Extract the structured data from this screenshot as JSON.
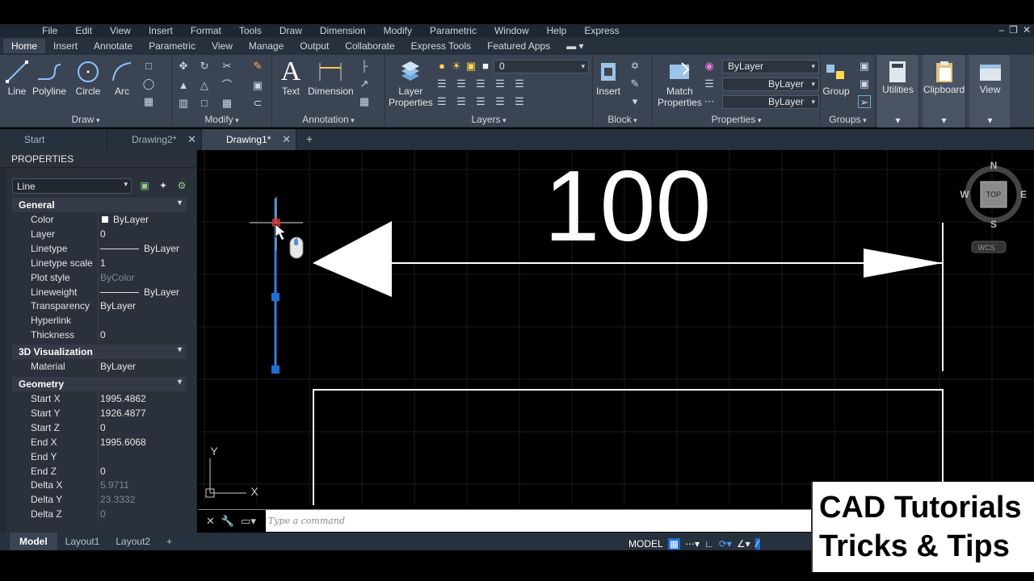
{
  "menu": {
    "items": [
      "File",
      "Edit",
      "View",
      "Insert",
      "Format",
      "Tools",
      "Draw",
      "Dimension",
      "Modify",
      "Parametric",
      "Window",
      "Help",
      "Express"
    ]
  },
  "ribbon_tabs": [
    "Home",
    "Insert",
    "Annotate",
    "Parametric",
    "View",
    "Manage",
    "Output",
    "Collaborate",
    "Express Tools",
    "Featured Apps"
  ],
  "ribbon": {
    "draw": {
      "title": "Draw",
      "line": "Line",
      "polyline": "Polyline",
      "circle": "Circle",
      "arc": "Arc"
    },
    "modify": {
      "title": "Modify"
    },
    "annotation": {
      "title": "Annotation",
      "text": "Text",
      "dimension": "Dimension"
    },
    "layers": {
      "title": "Layers",
      "layer_properties_1": "Layer",
      "layer_properties_2": "Properties",
      "current_layer": "0"
    },
    "block": {
      "title": "Block",
      "insert": "Insert"
    },
    "properties": {
      "title": "Properties",
      "match_1": "Match",
      "match_2": "Properties",
      "color": "ByLayer",
      "linetype": "ByLayer",
      "lineweight": "ByLayer"
    },
    "groups": {
      "title": "Groups",
      "group": "Group"
    },
    "utilities": "Utilities",
    "clipboard": "Clipboard",
    "view": "View"
  },
  "file_tabs": [
    {
      "label": "Start"
    },
    {
      "label": "Drawing2*"
    },
    {
      "label": "Drawing1*"
    }
  ],
  "properties_palette": {
    "title": "PROPERTIES",
    "object_type": "Line",
    "sections": {
      "general": "General",
      "vis3d": "3D Visualization",
      "geometry": "Geometry"
    },
    "general": [
      {
        "k": "Color",
        "v": "ByLayer"
      },
      {
        "k": "Layer",
        "v": "0"
      },
      {
        "k": "Linetype",
        "v": "ByLayer"
      },
      {
        "k": "Linetype scale",
        "v": "1"
      },
      {
        "k": "Plot style",
        "v": "ByColor"
      },
      {
        "k": "Lineweight",
        "v": "ByLayer"
      },
      {
        "k": "Transparency",
        "v": "ByLayer"
      },
      {
        "k": "Hyperlink",
        "v": ""
      },
      {
        "k": "Thickness",
        "v": "0"
      }
    ],
    "vis3d": [
      {
        "k": "Material",
        "v": "ByLayer"
      }
    ],
    "geometry": [
      {
        "k": "Start X",
        "v": "1995.4862"
      },
      {
        "k": "Start Y",
        "v": "1926.4877"
      },
      {
        "k": "Start Z",
        "v": "0"
      },
      {
        "k": "End X",
        "v": "1995.6068"
      },
      {
        "k": "End Y",
        "v": ""
      },
      {
        "k": "End Z",
        "v": "0"
      },
      {
        "k": "Delta X",
        "v": "5.9711"
      },
      {
        "k": "Delta Y",
        "v": "23.3332"
      },
      {
        "k": "Delta Z",
        "v": "0"
      }
    ]
  },
  "drawing": {
    "dimension_text": "100",
    "viewcube": {
      "n": "N",
      "s": "S",
      "e": "E",
      "w": "W",
      "top": "TOP",
      "wcs": "WCS"
    },
    "ucs": {
      "x": "X",
      "y": "Y"
    }
  },
  "command_line": {
    "placeholder": "Type a command"
  },
  "layout_tabs": [
    "Model",
    "Layout1",
    "Layout2"
  ],
  "status": {
    "model": "MODEL"
  },
  "watermark": {
    "line1": "CAD Tutorials",
    "line2": "Tricks & Tips"
  },
  "colors": {
    "ribbon": "#3b4453",
    "accent_grip": "#1e6fd9",
    "canvas": "#000000"
  }
}
